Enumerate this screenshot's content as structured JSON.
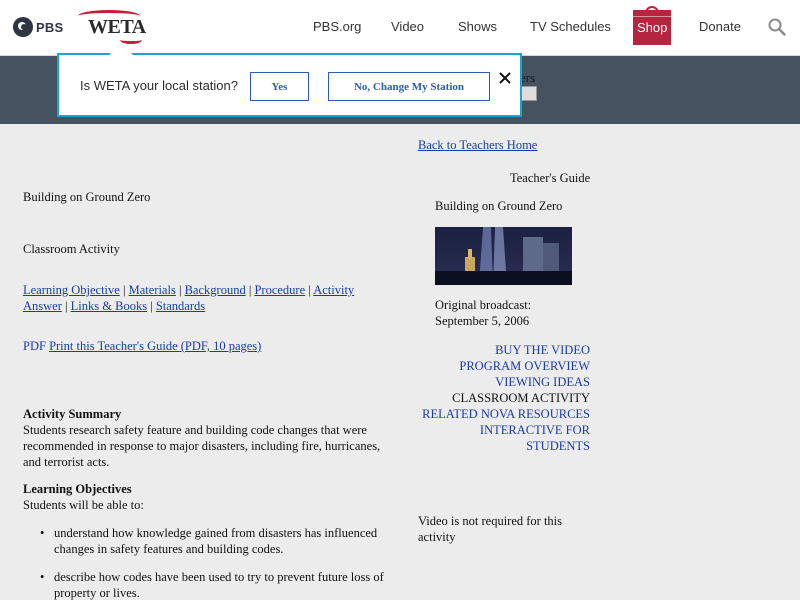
{
  "nav": {
    "pbs_logo": "PBS",
    "weta_logo": "WETA",
    "links": [
      "PBS.org",
      "Video",
      "Shows",
      "TV Schedules"
    ],
    "shop": "Shop",
    "donate": "Donate",
    "search_icon": "search-icon",
    "shop_color": "#b4263f"
  },
  "station_bar": {
    "partial_text": "ers"
  },
  "popup": {
    "question": "Is WETA your local station?",
    "yes": "Yes",
    "change": "No, Change My Station",
    "close_icon": "close-icon",
    "border_color": "#1aa3d5"
  },
  "left": {
    "title": "Building on Ground Zero",
    "subtitle": "Classroom Activity",
    "nav_links": [
      "Learning Objective",
      "Materials",
      "Background",
      "Procedure",
      "Activity Answer",
      "Links & Books",
      "Standards"
    ],
    "pdf_label": "PDF",
    "pdf_link": "Print this Teacher's Guide (PDF, 10 pages)",
    "summary_heading": "Activity Summary",
    "summary_text": "Students research safety feature and building code changes that were recommended in response to major disasters, including fire, hurricanes, and terrorist acts.",
    "objectives_heading": "Learning Objectives",
    "objectives_intro": "Students will be able to:",
    "objectives": [
      "understand how knowledge gained from disasters has influenced changes in safety features and building codes.",
      "describe how codes have been used to try to prevent future loss of property or lives."
    ]
  },
  "right": {
    "back_link": "Back to Teachers Home",
    "guide_label": "Teacher's Guide",
    "program_title": "Building on Ground Zero",
    "broadcast_label": "Original broadcast:",
    "broadcast_date": "September 5, 2006",
    "menu": [
      {
        "label": "BUY THE VIDEO",
        "active": false
      },
      {
        "label": "PROGRAM OVERVIEW",
        "active": false
      },
      {
        "label": "VIEWING IDEAS",
        "active": false
      },
      {
        "label": "CLASSROOM ACTIVITY",
        "active": true
      },
      {
        "label": "RELATED NOVA RESOURCES",
        "active": false
      },
      {
        "label": "INTERACTIVE FOR STUDENTS",
        "active": false
      }
    ],
    "video_note": "Video is not required for this activity"
  },
  "colors": {
    "link": "#1a3aa8",
    "station_bar": "#475260",
    "page_bg": "#ececec"
  }
}
